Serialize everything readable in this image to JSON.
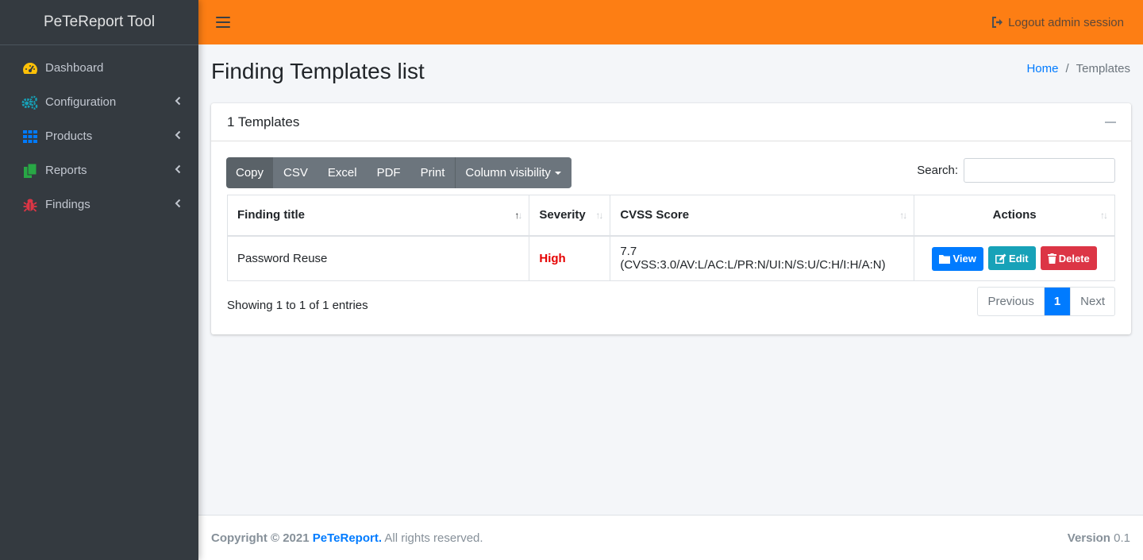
{
  "brand": "PeTeReport Tool",
  "sidebar": {
    "items": [
      {
        "label": "Dashboard",
        "icon": "tachometer-icon",
        "color": "#ffc107",
        "has_caret": false
      },
      {
        "label": "Configuration",
        "icon": "cogs-icon",
        "color": "#17a2b8",
        "has_caret": true
      },
      {
        "label": "Products",
        "icon": "th-icon",
        "color": "#007bff",
        "has_caret": true
      },
      {
        "label": "Reports",
        "icon": "copy-icon",
        "color": "#28a745",
        "has_caret": true
      },
      {
        "label": "Findings",
        "icon": "bug-icon",
        "color": "#dc3545",
        "has_caret": true
      }
    ]
  },
  "navbar": {
    "logout_label": "Logout admin session",
    "bg_color": "#fd7e14"
  },
  "page": {
    "title": "Finding Templates list",
    "breadcrumb": {
      "home": "Home",
      "separator": "/",
      "current": "Templates"
    }
  },
  "card": {
    "title": "1 Templates",
    "buttons": {
      "copy": "Copy",
      "csv": "CSV",
      "excel": "Excel",
      "pdf": "PDF",
      "print": "Print",
      "colvis": "Column visibility"
    },
    "search_label": "Search:",
    "search_value": "",
    "table": {
      "headers": {
        "title": "Finding title",
        "severity": "Severity",
        "cvss": "CVSS Score",
        "actions": "Actions"
      },
      "rows": [
        {
          "title": "Password Reuse",
          "severity": "High",
          "cvss": "7.7 (CVSS:3.0/AV:L/AC:L/PR:N/UI:N/S:U/C:H/I:H/A:N)"
        }
      ],
      "action_labels": {
        "view": "View",
        "edit": "Edit",
        "delete": "Delete"
      }
    },
    "info": "Showing 1 to 1 of 1 entries",
    "pagination": {
      "previous": "Previous",
      "current": "1",
      "next": "Next"
    }
  },
  "footer": {
    "copyright": "Copyright © 2021",
    "brand": "PeTeReport.",
    "rights": "All rights reserved.",
    "version_label": "Version",
    "version": "0.1"
  }
}
